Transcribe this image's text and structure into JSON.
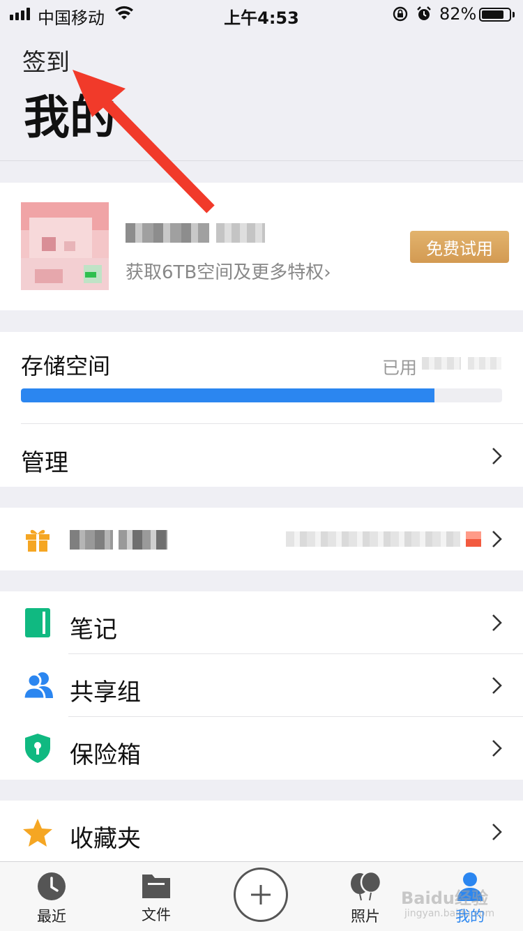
{
  "status_bar": {
    "carrier": "中国移动",
    "time": "上午4:53",
    "battery": "82%",
    "battery_level": 0.82
  },
  "header": {
    "signin_label": "签到",
    "title": "我的"
  },
  "profile": {
    "promo_text": "获取6TB空间及更多特权",
    "promo_arrow": "›",
    "trial_button": "免费试用"
  },
  "storage": {
    "title": "存储空间",
    "used_label": "已用",
    "usage_fraction": 0.86,
    "manage_label": "管理"
  },
  "menu": {
    "items": [
      {
        "label": "笔记",
        "icon": "notebook-icon"
      },
      {
        "label": "共享组",
        "icon": "users-icon"
      },
      {
        "label": "保险箱",
        "icon": "shield-lock-icon"
      },
      {
        "label": "收藏夹",
        "icon": "star-icon"
      }
    ]
  },
  "tabbar": {
    "tabs": [
      {
        "label": "最近",
        "icon": "clock-icon"
      },
      {
        "label": "文件",
        "icon": "folder-icon"
      },
      {
        "label": "照片",
        "icon": "balloons-icon"
      },
      {
        "label": "我的",
        "icon": "person-icon",
        "active": true
      }
    ]
  },
  "watermark": {
    "text": "Baidu经验",
    "sub": "jingyan.baidu.com"
  },
  "colors": {
    "accent": "#2b86f0",
    "trial": "#d9a55e",
    "annotation_arrow": "#f13a2a",
    "notebook": "#10b981",
    "star": "#f5a623",
    "gift": "#f5a623"
  }
}
